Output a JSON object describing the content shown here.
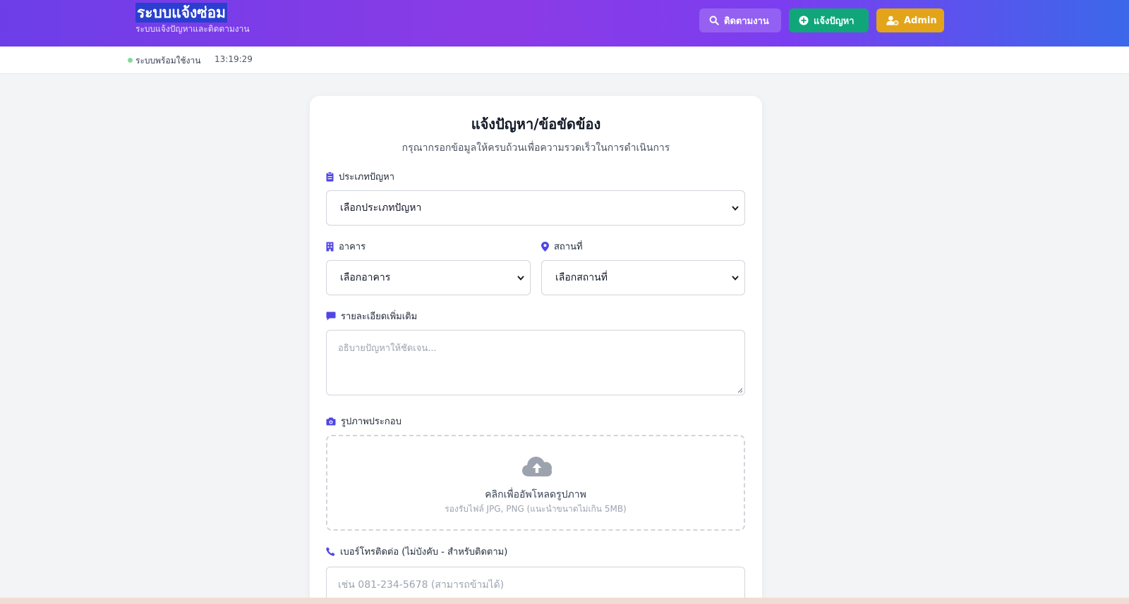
{
  "header": {
    "title": "ระบบแจ้งซ่อม",
    "subtitle": "ระบบแจ้งปัญหาและติดตามงาน",
    "nav": {
      "track_label": "ติดตามงาน",
      "report_label": "แจ้งปัญหา",
      "admin_label": "Admin"
    }
  },
  "status": {
    "text": "ระบบพร้อมใช้งาน",
    "time": "13:19:29"
  },
  "form": {
    "title": "แจ้งปัญหา/ข้อขัดข้อง",
    "subtitle": "กรุณากรอกข้อมูลให้ครบถ้วนเพื่อความรวดเร็วในการดำเนินการ",
    "problem_type": {
      "label": "ประเภทปัญหา",
      "value": "เลือกประเภทปัญหา"
    },
    "building": {
      "label": "อาคาร",
      "value": "เลือกอาคาร"
    },
    "location": {
      "label": "สถานที่",
      "value": "เลือกสถานที่"
    },
    "details": {
      "label": "รายละเอียดเพิ่มเติม",
      "placeholder": "อธิบายปัญหาให้ชัดเจน..."
    },
    "photo": {
      "label": "รูปภาพประกอบ",
      "main": "คลิกเพื่ออัพโหลดรูปภาพ",
      "hint": "รองรับไฟล์ JPG, PNG (แนะนำขนาดไม่เกิน 5MB)"
    },
    "phone": {
      "label": "เบอร์โทรติดต่อ (ไม่บังคับ - สำหรับติดตาม)",
      "placeholder": "เช่น 081-234-5678 (สามารถข้ามได้)"
    }
  },
  "colors": {
    "accent": "#4f46e5",
    "report_button": "#10a67a",
    "admin_button": "#e3a41a",
    "status_dot": "#86d99a"
  }
}
